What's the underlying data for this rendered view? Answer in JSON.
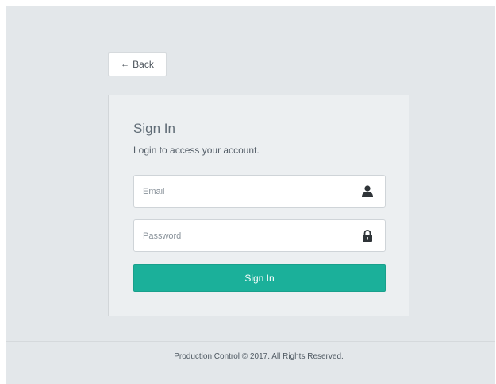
{
  "nav": {
    "back_arrow": "←",
    "back_label": "Back"
  },
  "signin": {
    "title": "Sign In",
    "subtitle": "Login to access your account.",
    "email_placeholder": "Email",
    "email_value": "",
    "email_icon": "user-icon",
    "password_placeholder": "Password",
    "password_value": "",
    "password_icon": "lock-icon",
    "submit_label": "Sign In"
  },
  "footer": {
    "text": "Production Control © 2017. All Rights Reserved."
  },
  "colors": {
    "background": "#e3e7ea",
    "card": "#eceff1",
    "accent": "#1bb09a"
  }
}
